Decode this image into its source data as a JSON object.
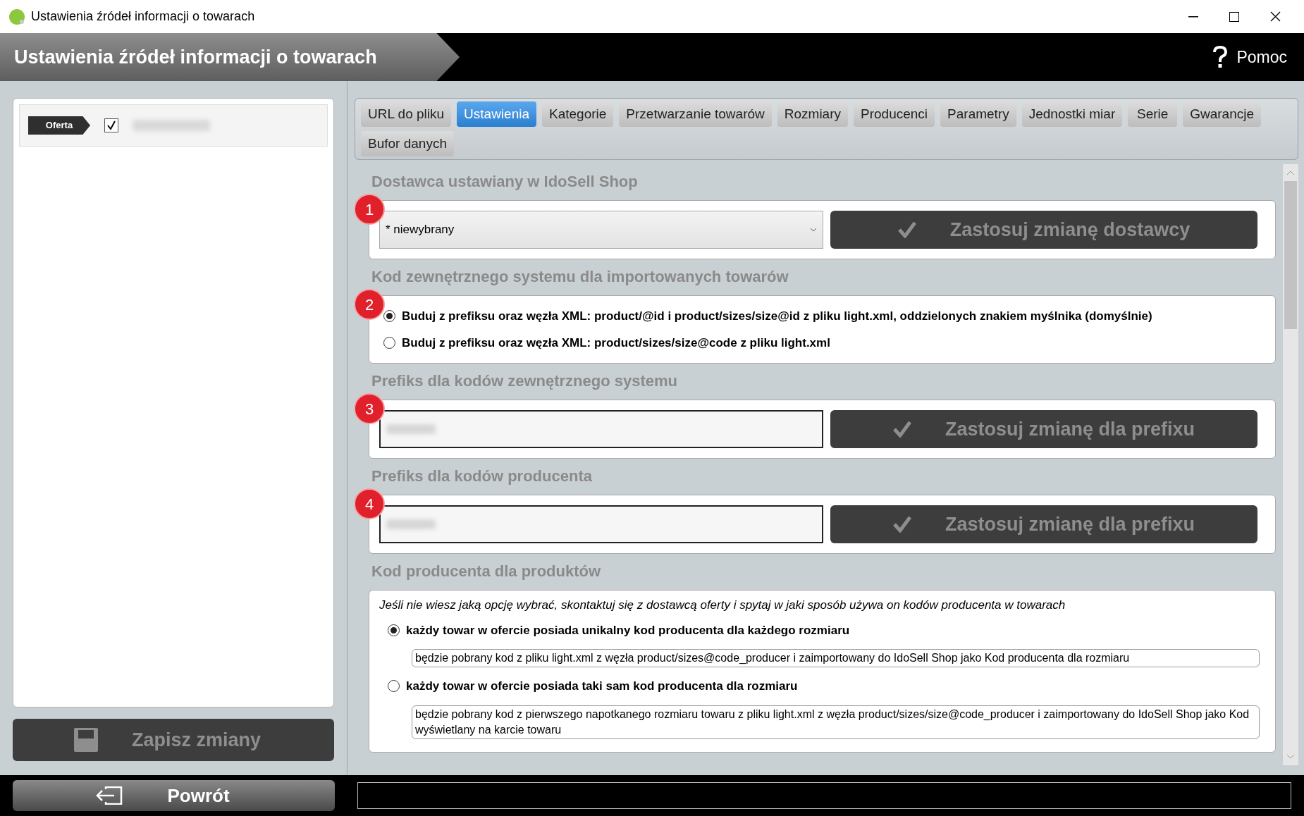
{
  "window": {
    "title": "Ustawienia źródeł informacji o towarach"
  },
  "header": {
    "title": "Ustawienia źródeł informacji o towarach",
    "help": "Pomoc"
  },
  "sources": [
    {
      "tag": "Oferta",
      "checked": true
    }
  ],
  "tabs": [
    {
      "label": "URL do pliku",
      "selected": false
    },
    {
      "label": "Ustawienia",
      "selected": true
    },
    {
      "label": "Kategorie",
      "selected": false
    },
    {
      "label": "Przetwarzanie towarów",
      "selected": false
    },
    {
      "label": "Rozmiary",
      "selected": false
    },
    {
      "label": "Producenci",
      "selected": false
    },
    {
      "label": "Parametry",
      "selected": false
    },
    {
      "label": "Jednostki miar",
      "selected": false
    },
    {
      "label": "Serie",
      "selected": false
    },
    {
      "label": "Gwarancje",
      "selected": false
    },
    {
      "label": "Bufor danych",
      "selected": false
    }
  ],
  "sections": [
    {
      "kind": "select",
      "number": "1",
      "heading": "Dostawca ustawiany w IdoSell Shop",
      "value": "* niewybrany",
      "button": "Zastosuj zmianę dostawcy"
    },
    {
      "kind": "radios",
      "number": "2",
      "heading": "Kod zewnętrznego systemu dla importowanych towarów",
      "options": [
        {
          "label": "Buduj z prefiksu oraz węzła XML: product/@id i product/sizes/size@id z pliku light.xml, oddzielonych znakiem myślnika (domyślnie)",
          "selected": true
        },
        {
          "label": "Buduj z prefiksu oraz węzła XML: product/sizes/size@code z pliku light.xml",
          "selected": false
        }
      ]
    },
    {
      "kind": "prefix",
      "number": "3",
      "heading": "Prefiks dla kodów zewnętrznego systemu",
      "button": "Zastosuj zmianę dla prefixu"
    },
    {
      "kind": "prefix",
      "number": "4",
      "heading": "Prefiks dla kodów producenta",
      "button": "Zastosuj zmianę dla prefixu"
    },
    {
      "kind": "producer",
      "heading": "Kod producenta dla produktów",
      "note": "Jeśli nie wiesz jaką opcję wybrać, skontaktuj się z dostawcą oferty i spytaj w jaki sposób używa on kodów producenta w towarach",
      "options": [
        {
          "label": "każdy towar w ofercie posiada unikalny kod producenta dla każdego rozmiaru",
          "selected": true,
          "description": "będzie pobrany kod z pliku light.xml z węzła product/sizes@code_producer i zaimportowany do IdoSell Shop jako Kod producenta dla rozmiaru"
        },
        {
          "label": "każdy towar w ofercie posiada taki sam kod producenta dla rozmiaru",
          "selected": false,
          "description": "będzie pobrany kod z pierwszego napotkanego rozmiaru towaru z pliku light.xml z węzła product/sizes/size@code_producer i zaimportowany do IdoSell Shop jako Kod wyświetlany na karcie towaru"
        }
      ]
    }
  ],
  "save_button": "Zapisz zmiany",
  "back_button": "Powrót"
}
